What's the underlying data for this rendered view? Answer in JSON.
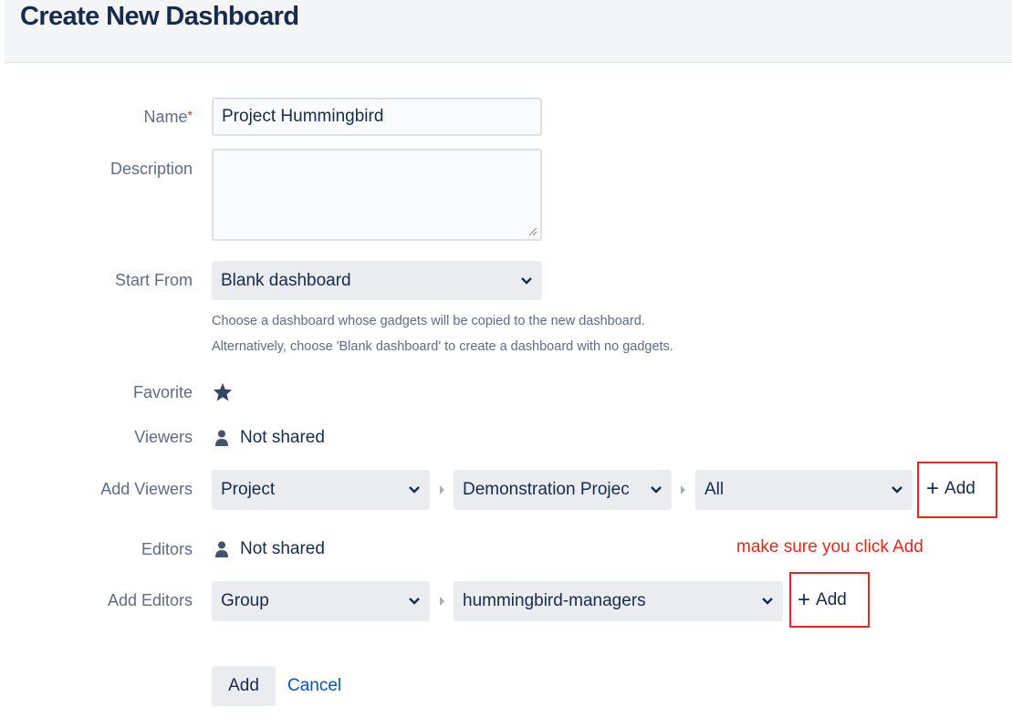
{
  "header": {
    "title": "Create New Dashboard"
  },
  "form": {
    "name": {
      "label": "Name",
      "required_mark": "*",
      "value": "Project Hummingbird"
    },
    "description": {
      "label": "Description",
      "value": ""
    },
    "start_from": {
      "label": "Start From",
      "value": "Blank dashboard",
      "help_line1": "Choose a dashboard whose gadgets will be copied to the new dashboard.",
      "help_line2": "Alternatively, choose 'Blank dashboard' to create a dashboard with no gadgets."
    },
    "favorite": {
      "label": "Favorite",
      "icon": "star-icon"
    },
    "viewers": {
      "label": "Viewers",
      "value": "Not shared",
      "icon": "user-icon"
    },
    "add_viewers": {
      "label": "Add Viewers",
      "type_value": "Project",
      "project_value": "Demonstration Projec",
      "role_value": "All",
      "add_label": "Add"
    },
    "editors": {
      "label": "Editors",
      "value": "Not shared",
      "icon": "user-icon"
    },
    "add_editors": {
      "label": "Add Editors",
      "type_value": "Group",
      "group_value": "hummingbird-managers",
      "add_label": "Add"
    },
    "annotation": "make sure you click Add",
    "submit_label": "Add",
    "cancel_label": "Cancel"
  },
  "colors": {
    "annotation_red": "#e8261b",
    "link_blue": "#0052cc",
    "text_dark": "#172b4d",
    "label_gray": "#5e6c84"
  }
}
